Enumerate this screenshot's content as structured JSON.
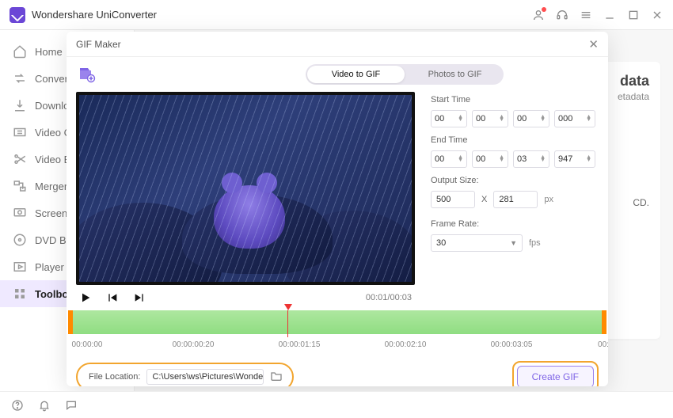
{
  "app": {
    "title": "Wondershare UniConverter"
  },
  "sidebar": {
    "items": [
      {
        "label": "Home"
      },
      {
        "label": "Converter"
      },
      {
        "label": "Downloader"
      },
      {
        "label": "Video Compressor"
      },
      {
        "label": "Video Editor"
      },
      {
        "label": "Merger"
      },
      {
        "label": "Screen Recorder"
      },
      {
        "label": "DVD Burner"
      },
      {
        "label": "Player"
      },
      {
        "label": "Toolbox"
      }
    ]
  },
  "background_card": {
    "title_fragment": "data",
    "subtitle_fragment": "etadata",
    "line_fragment": "CD."
  },
  "dialog": {
    "title": "GIF Maker",
    "tabs": {
      "video": "Video to GIF",
      "photos": "Photos to GIF"
    },
    "time": {
      "current": "00:01",
      "total": "00:03",
      "sep": "/"
    },
    "start_label": "Start Time",
    "end_label": "End Time",
    "start": {
      "hh": "00",
      "mm": "00",
      "ss": "00",
      "ms": "000"
    },
    "end": {
      "hh": "00",
      "mm": "00",
      "ss": "03",
      "ms": "947"
    },
    "output_label": "Output Size:",
    "output": {
      "w": "500",
      "h": "281",
      "unit": "px",
      "x": "X"
    },
    "fps_label": "Frame Rate:",
    "fps": {
      "value": "30",
      "unit": "fps"
    },
    "timeline": {
      "labels": [
        "00:00:00",
        "00:00:00:20",
        "00:00:01:15",
        "00:00:02:10",
        "00:00:03:05",
        "00:"
      ]
    },
    "location": {
      "label": "File Location:",
      "path": "C:\\Users\\ws\\Pictures\\Wonders"
    },
    "create_label": "Create GIF"
  }
}
